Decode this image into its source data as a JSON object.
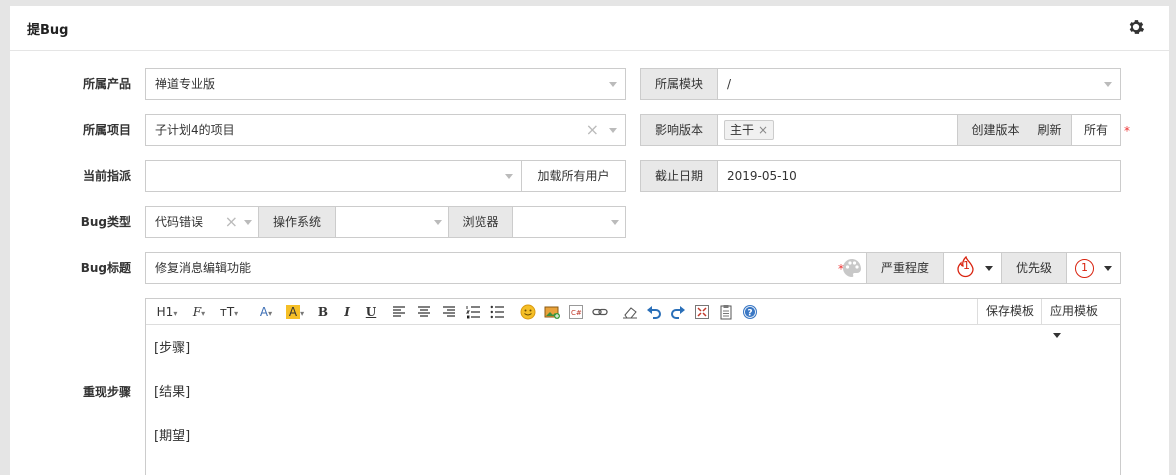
{
  "panel": {
    "title": "提Bug",
    "settings_icon": "gear-icon"
  },
  "form": {
    "product": {
      "label": "所属产品",
      "value": "禅道专业版"
    },
    "module": {
      "label": "所属模块",
      "value": "/"
    },
    "project": {
      "label": "所属项目",
      "value": "子计划4的项目"
    },
    "builds": {
      "label": "影响版本",
      "tag": "主干",
      "create_build": "创建版本",
      "refresh": "刷新",
      "all": "所有",
      "required": "*"
    },
    "assign": {
      "label": "当前指派",
      "value": "",
      "load_all": "加载所有用户"
    },
    "deadline": {
      "label": "截止日期",
      "value": "2019-05-10"
    },
    "bug_type": {
      "label": "Bug类型",
      "value": "代码错误",
      "os_label": "操作系统",
      "os_value": "",
      "browser_label": "浏览器",
      "browser_value": ""
    },
    "title": {
      "label": "Bug标题",
      "value": "修复消息编辑功能",
      "required": "*",
      "severity_label": "严重程度",
      "severity_value": "1",
      "priority_label": "优先级",
      "priority_value": "1"
    },
    "steps": {
      "label": "重现步骤",
      "lines": [
        "[步骤]",
        "[结果]",
        "[期望]"
      ],
      "save_template": "保存模板",
      "apply_template": "应用模板"
    }
  },
  "toolbar": {
    "heading": "H1",
    "font": "F",
    "size": "тT",
    "font_color": "A",
    "bg_color": "A",
    "bold": "B",
    "italic": "I",
    "underline": "U"
  },
  "colors": {
    "accent": "#f5bf27",
    "severity": "#d9230f",
    "required": "#e33333"
  }
}
